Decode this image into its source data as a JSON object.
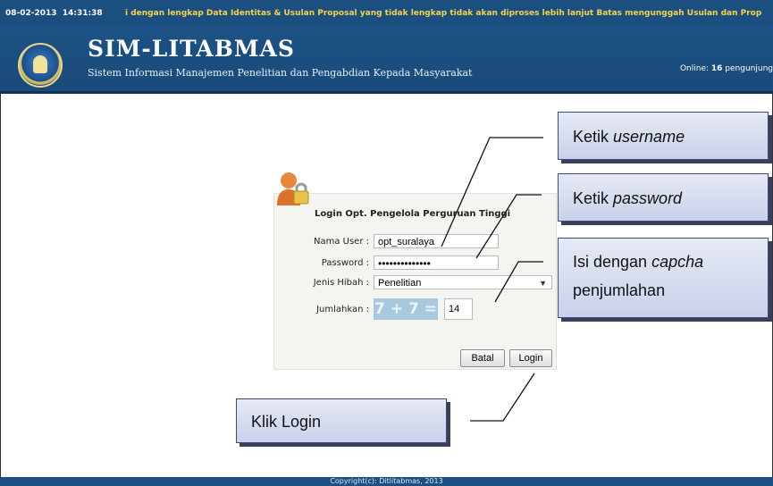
{
  "header": {
    "date": "08-02-2013",
    "time": "14:31:38",
    "ticker_text": "i dengan lengkap   Data Identitas & Usulan Proposal yang tidak lengkap tidak akan diproses lebih lanjut   Batas mengunggah Usulan dan Prop",
    "site_title": "SIM-LITABMAS",
    "site_subtitle": "Sistem Informasi Manajemen Penelitian dan Pengabdian Kepada Masyarakat",
    "online_label": "Online:",
    "online_count": "16",
    "online_suffix": "pengunjung"
  },
  "login": {
    "title": "Login Opt. Pengelola Perguruan Tinggi",
    "username_label": "Nama User :",
    "username_value": "opt_suralaya",
    "password_label": "Password :",
    "password_value": "••••••••••••••",
    "hibah_label": "Jenis  Hibah :",
    "hibah_value": "Penelitian",
    "captcha_label": "Jumlahkan :",
    "captcha_text": "7 + 7 =",
    "captcha_answer": "14",
    "cancel_button": "Batal",
    "login_button": "Login"
  },
  "callouts": {
    "username_prefix": "Ketik ",
    "username_em": "username",
    "password_prefix": "Ketik ",
    "password_em": "password",
    "captcha_line1_prefix": "Isi dengan ",
    "captcha_line1_em": "capcha",
    "captcha_line2": "penjumlahan",
    "login": "Klik Login"
  },
  "footer": {
    "copyright": "Copyright(c): Ditlitabmas, 2013"
  },
  "colors": {
    "header_bg": "#1b4f80",
    "ticker_text": "#f5d44a",
    "callout_bg": "#d6dcef",
    "callout_border": "#3c4a78"
  }
}
